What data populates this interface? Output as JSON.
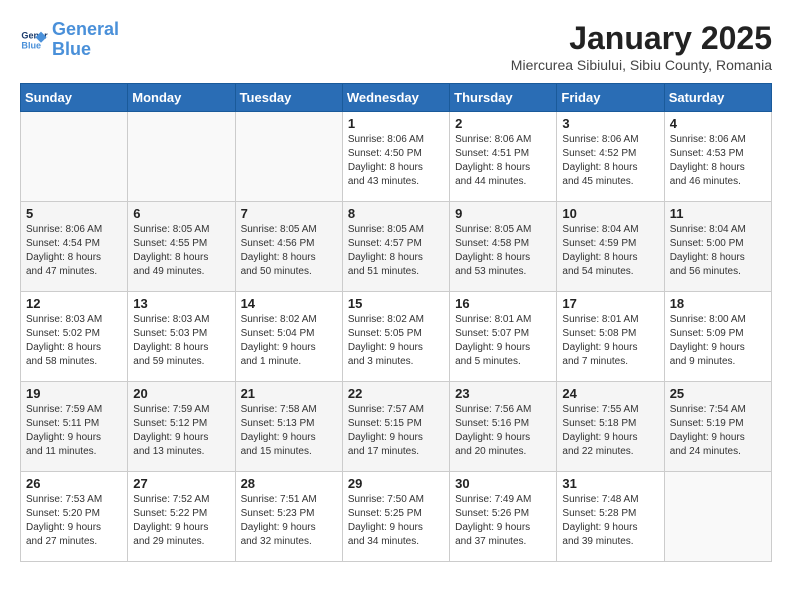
{
  "header": {
    "logo_line1": "General",
    "logo_line2": "Blue",
    "month": "January 2025",
    "location": "Miercurea Sibiului, Sibiu County, Romania"
  },
  "weekdays": [
    "Sunday",
    "Monday",
    "Tuesday",
    "Wednesday",
    "Thursday",
    "Friday",
    "Saturday"
  ],
  "weeks": [
    [
      {
        "day": "",
        "info": ""
      },
      {
        "day": "",
        "info": ""
      },
      {
        "day": "",
        "info": ""
      },
      {
        "day": "1",
        "info": "Sunrise: 8:06 AM\nSunset: 4:50 PM\nDaylight: 8 hours\nand 43 minutes."
      },
      {
        "day": "2",
        "info": "Sunrise: 8:06 AM\nSunset: 4:51 PM\nDaylight: 8 hours\nand 44 minutes."
      },
      {
        "day": "3",
        "info": "Sunrise: 8:06 AM\nSunset: 4:52 PM\nDaylight: 8 hours\nand 45 minutes."
      },
      {
        "day": "4",
        "info": "Sunrise: 8:06 AM\nSunset: 4:53 PM\nDaylight: 8 hours\nand 46 minutes."
      }
    ],
    [
      {
        "day": "5",
        "info": "Sunrise: 8:06 AM\nSunset: 4:54 PM\nDaylight: 8 hours\nand 47 minutes."
      },
      {
        "day": "6",
        "info": "Sunrise: 8:05 AM\nSunset: 4:55 PM\nDaylight: 8 hours\nand 49 minutes."
      },
      {
        "day": "7",
        "info": "Sunrise: 8:05 AM\nSunset: 4:56 PM\nDaylight: 8 hours\nand 50 minutes."
      },
      {
        "day": "8",
        "info": "Sunrise: 8:05 AM\nSunset: 4:57 PM\nDaylight: 8 hours\nand 51 minutes."
      },
      {
        "day": "9",
        "info": "Sunrise: 8:05 AM\nSunset: 4:58 PM\nDaylight: 8 hours\nand 53 minutes."
      },
      {
        "day": "10",
        "info": "Sunrise: 8:04 AM\nSunset: 4:59 PM\nDaylight: 8 hours\nand 54 minutes."
      },
      {
        "day": "11",
        "info": "Sunrise: 8:04 AM\nSunset: 5:00 PM\nDaylight: 8 hours\nand 56 minutes."
      }
    ],
    [
      {
        "day": "12",
        "info": "Sunrise: 8:03 AM\nSunset: 5:02 PM\nDaylight: 8 hours\nand 58 minutes."
      },
      {
        "day": "13",
        "info": "Sunrise: 8:03 AM\nSunset: 5:03 PM\nDaylight: 8 hours\nand 59 minutes."
      },
      {
        "day": "14",
        "info": "Sunrise: 8:02 AM\nSunset: 5:04 PM\nDaylight: 9 hours\nand 1 minute."
      },
      {
        "day": "15",
        "info": "Sunrise: 8:02 AM\nSunset: 5:05 PM\nDaylight: 9 hours\nand 3 minutes."
      },
      {
        "day": "16",
        "info": "Sunrise: 8:01 AM\nSunset: 5:07 PM\nDaylight: 9 hours\nand 5 minutes."
      },
      {
        "day": "17",
        "info": "Sunrise: 8:01 AM\nSunset: 5:08 PM\nDaylight: 9 hours\nand 7 minutes."
      },
      {
        "day": "18",
        "info": "Sunrise: 8:00 AM\nSunset: 5:09 PM\nDaylight: 9 hours\nand 9 minutes."
      }
    ],
    [
      {
        "day": "19",
        "info": "Sunrise: 7:59 AM\nSunset: 5:11 PM\nDaylight: 9 hours\nand 11 minutes."
      },
      {
        "day": "20",
        "info": "Sunrise: 7:59 AM\nSunset: 5:12 PM\nDaylight: 9 hours\nand 13 minutes."
      },
      {
        "day": "21",
        "info": "Sunrise: 7:58 AM\nSunset: 5:13 PM\nDaylight: 9 hours\nand 15 minutes."
      },
      {
        "day": "22",
        "info": "Sunrise: 7:57 AM\nSunset: 5:15 PM\nDaylight: 9 hours\nand 17 minutes."
      },
      {
        "day": "23",
        "info": "Sunrise: 7:56 AM\nSunset: 5:16 PM\nDaylight: 9 hours\nand 20 minutes."
      },
      {
        "day": "24",
        "info": "Sunrise: 7:55 AM\nSunset: 5:18 PM\nDaylight: 9 hours\nand 22 minutes."
      },
      {
        "day": "25",
        "info": "Sunrise: 7:54 AM\nSunset: 5:19 PM\nDaylight: 9 hours\nand 24 minutes."
      }
    ],
    [
      {
        "day": "26",
        "info": "Sunrise: 7:53 AM\nSunset: 5:20 PM\nDaylight: 9 hours\nand 27 minutes."
      },
      {
        "day": "27",
        "info": "Sunrise: 7:52 AM\nSunset: 5:22 PM\nDaylight: 9 hours\nand 29 minutes."
      },
      {
        "day": "28",
        "info": "Sunrise: 7:51 AM\nSunset: 5:23 PM\nDaylight: 9 hours\nand 32 minutes."
      },
      {
        "day": "29",
        "info": "Sunrise: 7:50 AM\nSunset: 5:25 PM\nDaylight: 9 hours\nand 34 minutes."
      },
      {
        "day": "30",
        "info": "Sunrise: 7:49 AM\nSunset: 5:26 PM\nDaylight: 9 hours\nand 37 minutes."
      },
      {
        "day": "31",
        "info": "Sunrise: 7:48 AM\nSunset: 5:28 PM\nDaylight: 9 hours\nand 39 minutes."
      },
      {
        "day": "",
        "info": ""
      }
    ]
  ]
}
